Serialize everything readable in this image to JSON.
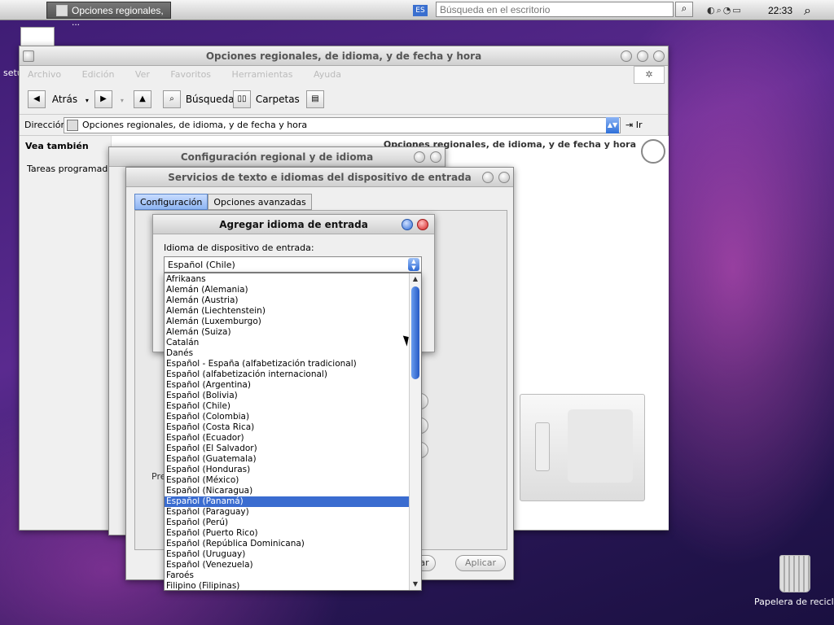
{
  "topbar": {
    "task_title": "Opciones regionales, ...",
    "lang_indicator": "ES",
    "search_placeholder": "Búsqueda en el escritorio",
    "clock": "22:33"
  },
  "desktop": {
    "setup_label": "setu",
    "trash_label": "Papelera de reciclaje"
  },
  "main_window": {
    "title": "Opciones regionales, de idioma, y de fecha y hora",
    "menu": [
      "Archivo",
      "Edición",
      "Ver",
      "Favoritos",
      "Herramientas",
      "Ayuda"
    ],
    "toolbar": {
      "back": "Atrás",
      "search": "Búsqueda",
      "folders": "Carpetas"
    },
    "address_label": "Dirección",
    "address_value": "Opciones regionales, de idioma, y de fecha y hora",
    "go_label": "Ir",
    "left_heading": "Vea también",
    "left_item": "Tareas programadas",
    "content_title": "Opciones regionales, de idioma, y de fecha y hora"
  },
  "regional_dialog": {
    "title": "Configuración regional y de idioma"
  },
  "services_dialog": {
    "title": "Servicios de texto e idiomas del dispositivo de entrada",
    "tabs": [
      "Configuración",
      "Opciones avanzadas"
    ],
    "pref_label": "Pre",
    "apply_button": "Aplicar",
    "partial_button": "ar"
  },
  "add_dialog": {
    "title": "Agregar idioma de entrada",
    "label": "Idioma de dispositivo de entrada:",
    "selected_value": "Español (Chile)",
    "options": [
      "Afrikaans",
      "Alemán (Alemania)",
      "Alemán (Austria)",
      "Alemán (Liechtenstein)",
      "Alemán (Luxemburgo)",
      "Alemán (Suiza)",
      "Catalán",
      "Danés",
      "Español - España (alfabetización tradicional)",
      "Español (alfabetización internacional)",
      "Español (Argentina)",
      "Español (Bolivia)",
      "Español (Chile)",
      "Español (Colombia)",
      "Español (Costa Rica)",
      "Español (Ecuador)",
      "Español (El Salvador)",
      "Español (Guatemala)",
      "Español (Honduras)",
      "Español (México)",
      "Español (Nicaragua)",
      "Español (Panamá)",
      "Español (Paraguay)",
      "Español (Perú)",
      "Español (Puerto Rico)",
      "Español (República Dominicana)",
      "Español (Uruguay)",
      "Español (Venezuela)",
      "Faroés",
      "Filipino (Filipinas)"
    ],
    "highlighted_option": "Español (Panamá)"
  }
}
